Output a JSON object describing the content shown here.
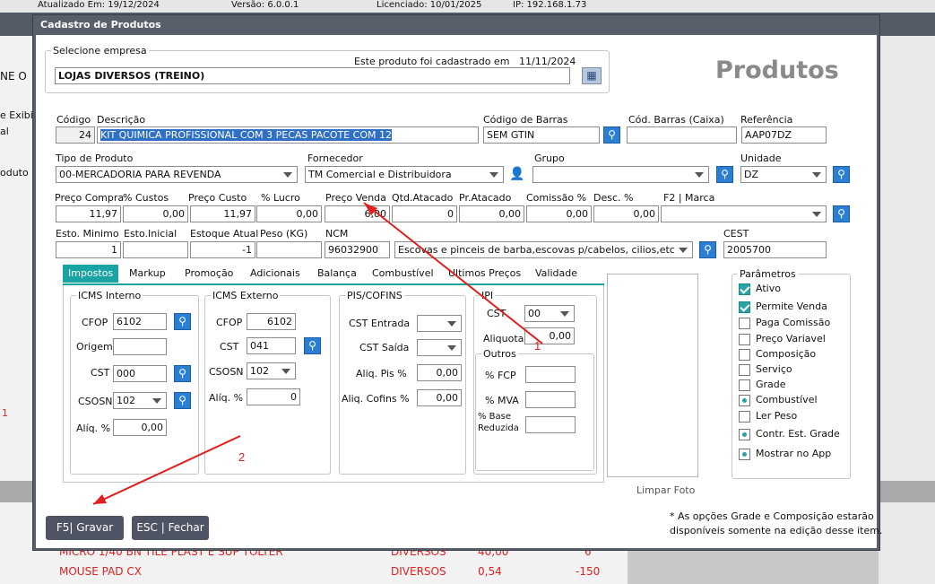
{
  "statusbar": {
    "updated": "Atualizado Em: 19/12/2024",
    "version": "Versão: 6.0.0.1",
    "licensed": "Licenciado: 10/01/2025",
    "ip": "IP: 192.168.1.73"
  },
  "background": {
    "left_labels": [
      "NE O",
      "e Exibiç",
      "al",
      "oduto",
      "1"
    ],
    "bottom_rows": [
      {
        "desc": "MICRO 1/40 BN TILE PLAST E SUP TOLTER",
        "group": "DIVERSOS",
        "price": "40,00",
        "qty": "6"
      },
      {
        "desc": "MOUSE PAD  CX",
        "group": "DIVERSOS",
        "price": "0,54",
        "qty": "-150"
      }
    ]
  },
  "window": {
    "title": "Cadastro de Produtos"
  },
  "empresa": {
    "label": "Selecione empresa",
    "value": "LOJAS DIVERSOS (TREINO)",
    "cadastro_text": "Este produto foi cadastrado em",
    "cadastro_date": "11/11/2024"
  },
  "header_title": "Produtos",
  "fields": {
    "codigo_label": "Código",
    "codigo": "24",
    "descricao_label": "Descrição",
    "descricao": "KIT QUIMICA PROFISSIONAL COM 3 PECAS PACOTE COM 12",
    "barras_label": "Código de Barras",
    "barras": "SEM GTIN",
    "barras_caixa_label": "Cód. Barras (Caixa)",
    "barras_caixa": "",
    "referencia_label": "Referência",
    "referencia": "AAP07DZ",
    "tipo_label": "Tipo de Produto",
    "tipo": "00-MERCADORIA PARA REVENDA",
    "fornecedor_label": "Fornecedor",
    "fornecedor": "TM Comercial e Distribuidora",
    "grupo_label": "Grupo",
    "grupo": "",
    "unidade_label": "Unidade",
    "unidade": "DZ",
    "preco_compra_label": "Preço Compra",
    "preco_compra": "11,97",
    "custos_label": "% Custos",
    "custos": "0,00",
    "preco_custo_label": "Preço Custo",
    "preco_custo": "11,97",
    "lucro_label": "% Lucro",
    "lucro": "0,00",
    "preco_venda_label": "Preço Venda",
    "preco_venda": "6,00",
    "qtd_atacado_label": "Qtd.Atacado",
    "qtd_atacado": "0",
    "pr_atacado_label": "Pr.Atacado",
    "pr_atacado": "0,00",
    "comissao_label": "Comissão %",
    "comissao": "0,00",
    "desc_label": "Desc. %",
    "desc": "0,00",
    "marca_label": "F2 | Marca",
    "marca": "",
    "esto_min_label": "Esto. Minimo",
    "esto_min": "1",
    "esto_ini_label": "Esto.Inicial",
    "esto_ini": "",
    "estoque_label": "Estoque Atual",
    "estoque": "-1",
    "peso_label": "Peso (KG)",
    "peso": "",
    "ncm_label": "NCM",
    "ncm": "96032900",
    "ncm_desc": "Escovas e pinceis de barba,escovas p/cabelos, cilios,etc",
    "cest_label": "CEST",
    "cest": "2005700"
  },
  "tabs": [
    "Impostos",
    "Markup",
    "Promoção",
    "Adicionais",
    "Balança",
    "Combustível",
    "Ultimos Preços",
    "Validade"
  ],
  "icms_interno": {
    "title": "ICMS Interno",
    "cfop_label": "CFOP",
    "cfop": "6102",
    "origem_label": "Origem",
    "origem": "",
    "cst_label": "CST",
    "cst": "000",
    "csosn_label": "CSOSN",
    "csosn": "102",
    "aliq_label": "Alíq. %",
    "aliq": "0,00"
  },
  "icms_externo": {
    "title": "ICMS Externo",
    "cfop_label": "CFOP",
    "cfop": "6102",
    "cst_label": "CST",
    "cst": "041",
    "csosn_label": "CSOSN",
    "csosn": "102",
    "aliq_label": "Alíq. %",
    "aliq": "0"
  },
  "pis": {
    "title": "PIS/COFINS",
    "cst_entrada_label": "CST Entrada",
    "cst_saida_label": "CST Saída",
    "aliq_pis_label": "Aliq. Pis %",
    "aliq_pis": "0,00",
    "aliq_cofins_label": "Aliq. Cofins %",
    "aliq_cofins": "0,00"
  },
  "ipi": {
    "title": "IPI",
    "cst_label": "CST",
    "cst": "00",
    "aliquota_label": "Aliquota",
    "aliquota": "0,00"
  },
  "outros": {
    "title": "Outros",
    "fcp_label": "% FCP",
    "mva_label": "% MVA",
    "base_label_1": "% Base",
    "base_label_2": "Reduzida"
  },
  "foto": {
    "clear_label": "Limpar Foto"
  },
  "parametros": {
    "title": "Parâmetros",
    "items": [
      {
        "label": "Ativo",
        "state": "checked"
      },
      {
        "label": "Permite Venda",
        "state": "checked"
      },
      {
        "label": "Paga Comissão",
        "state": "off"
      },
      {
        "label": "Preço Variavel",
        "state": "off"
      },
      {
        "label": "Composição",
        "state": "off"
      },
      {
        "label": "Serviço",
        "state": "off"
      },
      {
        "label": "Grade",
        "state": "off"
      },
      {
        "label": "Combustível",
        "state": "dot"
      },
      {
        "label": "Ler Peso",
        "state": "off"
      },
      {
        "label": "Contr. Est. Grade",
        "state": "dot"
      },
      {
        "label": "Mostrar no App",
        "state": "dot"
      }
    ]
  },
  "note": {
    "line1": "* As opções Grade e Composição estarão",
    "line2": "disponíveis somente na edição desse item."
  },
  "buttons": {
    "save": "F5| Gravar",
    "close": "ESC | Fechar"
  },
  "annotations": {
    "one": "1",
    "two": "2",
    "color": "#e02020"
  }
}
